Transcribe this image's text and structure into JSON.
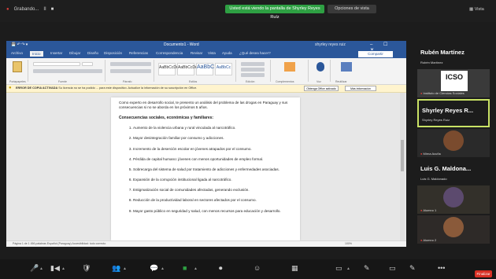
{
  "zoom_top": {
    "left_items": [
      "Grabando...",
      "II",
      "■"
    ],
    "banner": "Usted está viendo la pantalla de Shyrley Reyes Ruíz",
    "view_options": "Opciones de vista",
    "right": "Vista"
  },
  "word": {
    "title": "Documento1 - Word",
    "user": "shyrley reyes ruiz",
    "tabs": [
      "Archivo",
      "Inicio",
      "Insertar",
      "Dibujar",
      "Diseño",
      "Disposición",
      "Referencias",
      "Correspondencia",
      "Revisar",
      "Vista",
      "Ayuda",
      "¿Qué desea hacer?"
    ],
    "share_label": "Compartir",
    "styles": [
      "AaBbCcDd",
      "AaBbCcDd",
      "AaBbC",
      "AaBbCc"
    ],
    "ribbon_labels": [
      "Portapapeles",
      "Fuente",
      "Párrafo",
      "Estilos",
      "Edición",
      "Complementos",
      "Voz",
      "Reutilizar"
    ],
    "message_bar": {
      "label": "ERROR DE COPIA ACTIVADA",
      "text": "Su licencia no se ha podido ... para este dispositivo. Actualice la información de su suscripción en Office.",
      "btn1": "Obtenga Office activado",
      "btn2": "Más información"
    },
    "document": {
      "intro": "Como experto en desarrollo social, te presento un análisis del problema de las drogas en Paraguay y sus consecuencias si no se aborda en los próximos 5 años.",
      "heading": "Consecuencias sociales, económicas y familiares:",
      "items": [
        "Aumento de la violencia urbana y rural vinculada al narcotráfico.",
        "Mayor desintegración familiar por consumo y adicciones.",
        "Incremento de la deserción escolar en jóvenes atrapados por el consumo.",
        "Pérdida de capital humano: jóvenes con menos oportunidades de empleo formal.",
        "Sobrecarga del sistema de salud por tratamiento de adicciones y enfermedades asociadas.",
        "Expansión de la corrupción institucional ligada al narcotráfico.",
        "Estigmatización social de comunidades afectadas, generando exclusión.",
        "Reducción de la productividad laboral en sectores afectados por el consumo.",
        "Mayor gasto público en seguridad y salud, con menos recursos para educación y desarrollo."
      ]
    },
    "status": "Página 1 de 1   456 palabras   Español (Paraguay)   Accesibilidad: todo correcto",
    "zoom": "100%"
  },
  "participants": [
    {
      "name": "Rubén Martínez",
      "label": "Rubén Martínez"
    },
    {
      "name": "",
      "label": "Instituto de Ciencias Sociales",
      "logo": "ICSO"
    },
    {
      "name": "Shyrley Reyes R...",
      "label": "Shyrley Reyes Ruíz"
    },
    {
      "name": "",
      "label": "Mirna Acuña"
    },
    {
      "name": "Luis G. Maldona...",
      "label": "Luis G. Maldonado"
    },
    {
      "name": "",
      "label": "Alumno 1"
    },
    {
      "name": "",
      "label": "Alumno 2"
    }
  ],
  "toolbar": {
    "items": [
      "Audio",
      "Video",
      "Seguridad",
      "Participantes",
      "Chat",
      "Compartir",
      "Grabar",
      "Reacciones",
      "Apps",
      "Pizarras",
      "Notas",
      "Más"
    ],
    "end_label": "Finalizar"
  },
  "colors": {
    "word_blue": "#2b579a",
    "banner_green": "#2ea043",
    "end_red": "#d93025"
  }
}
